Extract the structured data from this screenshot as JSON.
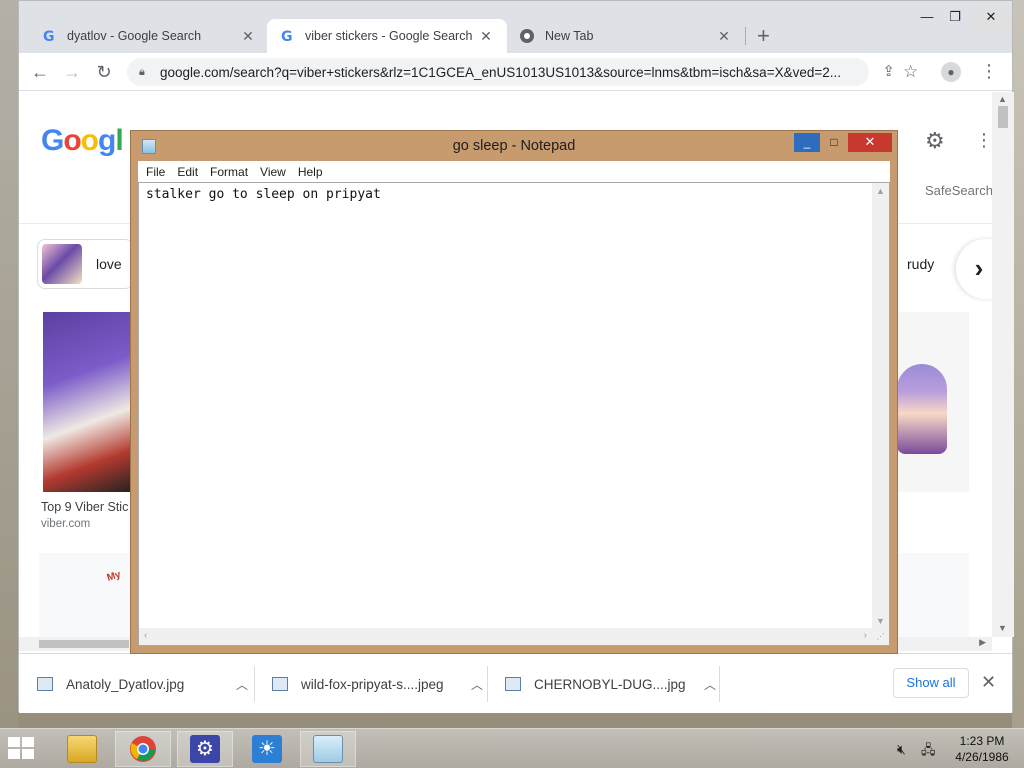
{
  "browser": {
    "tabs": [
      {
        "label": "dyatlov - Google Search",
        "favicon": "google-g-icon",
        "active": false
      },
      {
        "label": "viber stickers - Google Search",
        "favicon": "google-g-icon",
        "active": true
      },
      {
        "label": "New Tab",
        "favicon": "chrome-icon",
        "active": false
      }
    ],
    "new_tab_symbol": "+",
    "window_controls": {
      "minimize": "—",
      "maximize": "❐",
      "close": "✕"
    },
    "nav": {
      "back": "←",
      "forward": "→",
      "reload": "↻"
    },
    "url": "google.com/search?q=viber+stickers&rlz=1C1GCEA_enUS1013US1013&source=lnms&tbm=isch&sa=X&ved=2...",
    "toolbar_icons": [
      "share-icon",
      "star-icon",
      "profile-icon",
      "menu-icon"
    ]
  },
  "search_page": {
    "logo": {
      "G": "G",
      "o1": "o",
      "o2": "o",
      "g": "g",
      "l": "l"
    },
    "safesearch": "SafeSearch",
    "chips": [
      {
        "label": "love"
      },
      {
        "label": "rudy"
      }
    ],
    "next_symbol": "›",
    "results": [
      {
        "title": "Top 9 Viber Stic",
        "source": "viber.com"
      }
    ],
    "sticker_text": "My"
  },
  "downloads": {
    "items": [
      {
        "filename": "Anatoly_Dyatlov.jpg"
      },
      {
        "filename": "wild-fox-pripyat-s....jpeg"
      },
      {
        "filename": "CHERNOBYL-DUG....jpg"
      }
    ],
    "show_all": "Show all",
    "close_symbol": "✕"
  },
  "notepad": {
    "title": "go sleep - Notepad",
    "menu": [
      "File",
      "Edit",
      "Format",
      "View",
      "Help"
    ],
    "content": "stalker go to sleep on pripyat",
    "controls": {
      "minimize": "_",
      "maximize": "□",
      "close": "✕"
    }
  },
  "taskbar": {
    "apps": [
      "file-explorer-icon",
      "chrome-icon",
      "settings-icon",
      "brightness-icon",
      "notepad-icon"
    ],
    "time": "1:23 PM",
    "date": "4/26/1986"
  },
  "colors": {
    "google_blue": "#4285f4",
    "google_red": "#ea4335",
    "google_yellow": "#fbbc05",
    "google_green": "#34a853",
    "notepad_frame": "#c89b6e",
    "notepad_close": "#c7392e",
    "link_blue": "#1a73e8"
  }
}
